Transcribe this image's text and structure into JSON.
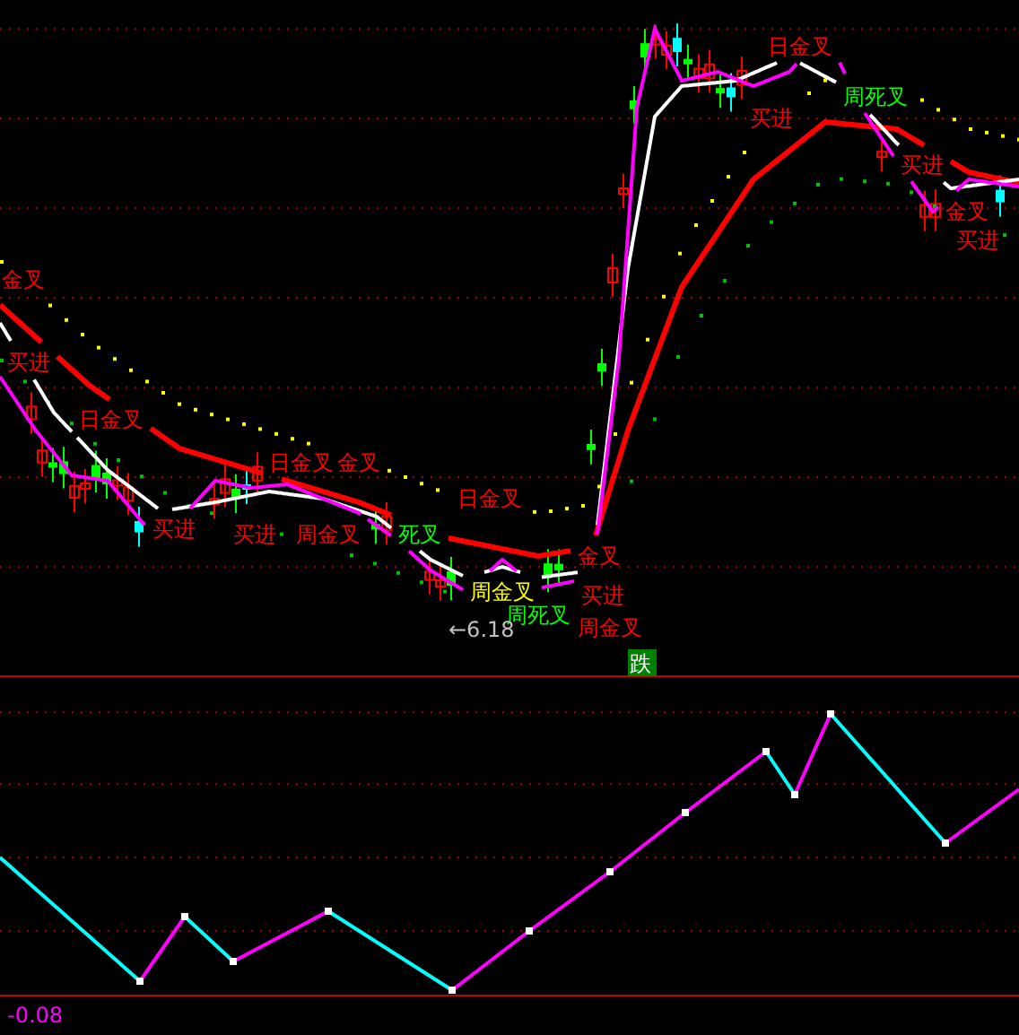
{
  "price_pane": {
    "signals": [
      {
        "text": "金叉",
        "color": "#ff0000"
      },
      {
        "text": "买进",
        "color": "#ff0000"
      },
      {
        "text": "日金叉",
        "color": "#ff0000"
      },
      {
        "text": "买进",
        "color": "#ff0000"
      },
      {
        "text": "日金叉",
        "color": "#ff0000"
      },
      {
        "text": "金叉",
        "color": "#ff0000"
      },
      {
        "text": "买进",
        "color": "#ff0000"
      },
      {
        "text": "周金叉",
        "color": "#ff0000"
      },
      {
        "text": "死叉",
        "color": "#00ff00"
      },
      {
        "text": "日金叉",
        "color": "#ff0000"
      },
      {
        "text": "周金叉",
        "color": "#ffff00"
      },
      {
        "text": "周死叉",
        "color": "#00ff00"
      },
      {
        "text": "金叉",
        "color": "#ff0000"
      },
      {
        "text": "买进",
        "color": "#ff0000"
      },
      {
        "text": "周金叉",
        "color": "#ff0000"
      },
      {
        "text": "日金叉",
        "color": "#ff0000"
      },
      {
        "text": "买进",
        "color": "#ff0000"
      },
      {
        "text": "周死叉",
        "color": "#00ff00"
      },
      {
        "text": "买进",
        "color": "#ff0000"
      },
      {
        "text": "金叉",
        "color": "#ff0000"
      },
      {
        "text": "买进",
        "color": "#ff0000"
      }
    ],
    "price_marker": "←6.18",
    "trend_badge": "跌"
  },
  "indicator_pane": {
    "value": "-0.08"
  }
}
